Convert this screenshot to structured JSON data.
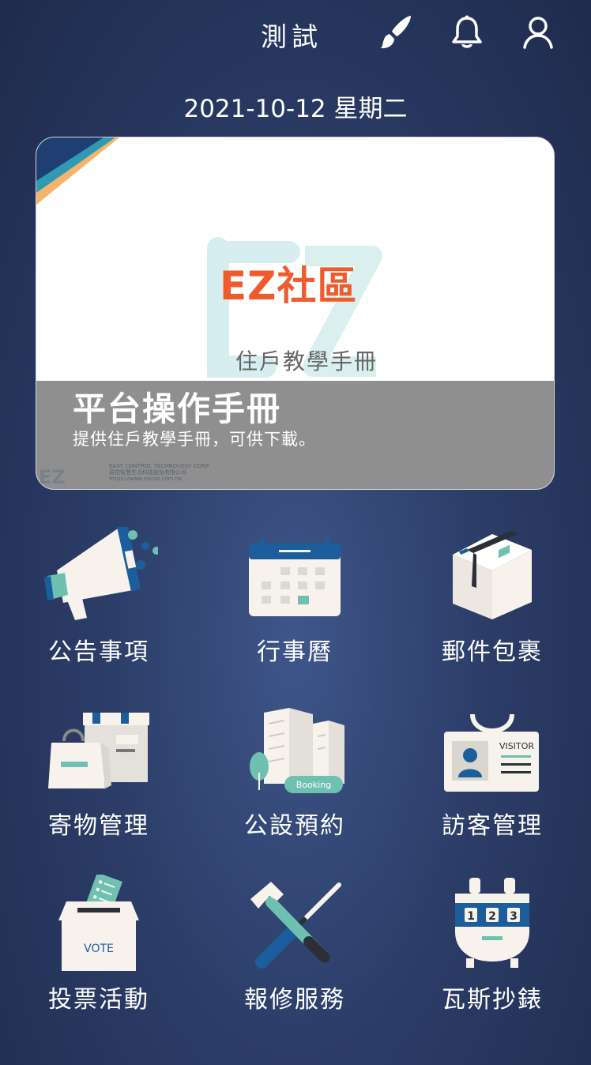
{
  "header": {
    "title": "測試",
    "icons": [
      "brush-icon",
      "bell-icon",
      "user-icon"
    ]
  },
  "date_text": "2021-10-12 星期二",
  "banner": {
    "logo_text": "EZ社區",
    "image_subtitle": "住戶教學手冊",
    "heading": "平台操作手冊",
    "description": "提供住戶教學手冊，可供下載。",
    "corp_line1": "EASY CONTROL TECHNOLOGY CORP",
    "corp_line2": "易控智慧生活科技股份有限公司",
    "corp_url": "https://www.ezcon.com.tw"
  },
  "features": [
    {
      "label": "公告事項",
      "icon": "megaphone-icon"
    },
    {
      "label": "行事曆",
      "icon": "calendar-icon"
    },
    {
      "label": "郵件包裹",
      "icon": "package-icon"
    },
    {
      "label": "寄物管理",
      "icon": "storage-bag-icon"
    },
    {
      "label": "公設預約",
      "icon": "booking-building-icon",
      "badge": "Booking"
    },
    {
      "label": "訪客管理",
      "icon": "visitor-badge-icon",
      "badge": "VISITOR"
    },
    {
      "label": "投票活動",
      "icon": "ballot-box-icon",
      "badge": "VOTE"
    },
    {
      "label": "報修服務",
      "icon": "repair-tools-icon"
    },
    {
      "label": "瓦斯抄錶",
      "icon": "gas-meter-icon",
      "digits": [
        "1",
        "2",
        "3"
      ]
    }
  ]
}
